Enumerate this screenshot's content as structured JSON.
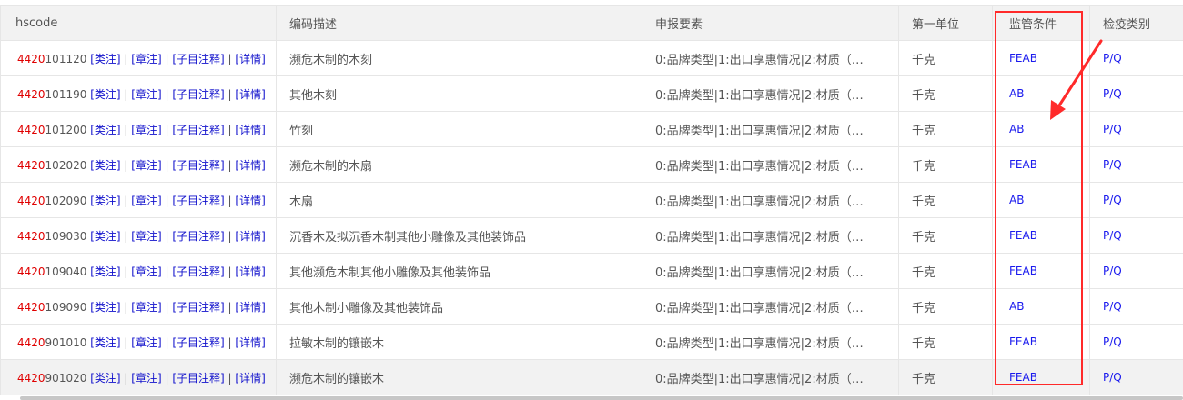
{
  "table": {
    "headers": [
      "hscode",
      "编码描述",
      "申报要素",
      "第一单位",
      "监管条件",
      "检疫类别"
    ],
    "link_labels": [
      "[类注]",
      "[章注]",
      "[子目注释]",
      "[详情]"
    ],
    "separator": "|",
    "rows": [
      {
        "prefix": "4420",
        "suffix": "101120",
        "desc": "濒危木制的木刻",
        "elements": "0:品牌类型|1:出口享惠情况|2:材质（…",
        "unit": "千克",
        "supervision": "FEAB",
        "quarantine": "P/Q"
      },
      {
        "prefix": "4420",
        "suffix": "101190",
        "desc": "其他木刻",
        "elements": "0:品牌类型|1:出口享惠情况|2:材质（…",
        "unit": "千克",
        "supervision": "AB",
        "quarantine": "P/Q"
      },
      {
        "prefix": "4420",
        "suffix": "101200",
        "desc": "竹刻",
        "elements": "0:品牌类型|1:出口享惠情况|2:材质（…",
        "unit": "千克",
        "supervision": "AB",
        "quarantine": "P/Q"
      },
      {
        "prefix": "4420",
        "suffix": "102020",
        "desc": "濒危木制的木扇",
        "elements": "0:品牌类型|1:出口享惠情况|2:材质（…",
        "unit": "千克",
        "supervision": "FEAB",
        "quarantine": "P/Q"
      },
      {
        "prefix": "4420",
        "suffix": "102090",
        "desc": "木扇",
        "elements": "0:品牌类型|1:出口享惠情况|2:材质（…",
        "unit": "千克",
        "supervision": "AB",
        "quarantine": "P/Q"
      },
      {
        "prefix": "4420",
        "suffix": "109030",
        "desc": "沉香木及拟沉香木制其他小雕像及其他装饰品",
        "elements": "0:品牌类型|1:出口享惠情况|2:材质（…",
        "unit": "千克",
        "supervision": "FEAB",
        "quarantine": "P/Q"
      },
      {
        "prefix": "4420",
        "suffix": "109040",
        "desc": "其他濒危木制其他小雕像及其他装饰品",
        "elements": "0:品牌类型|1:出口享惠情况|2:材质（…",
        "unit": "千克",
        "supervision": "FEAB",
        "quarantine": "P/Q"
      },
      {
        "prefix": "4420",
        "suffix": "109090",
        "desc": "其他木制小雕像及其他装饰品",
        "elements": "0:品牌类型|1:出口享惠情况|2:材质（…",
        "unit": "千克",
        "supervision": "AB",
        "quarantine": "P/Q"
      },
      {
        "prefix": "4420",
        "suffix": "901010",
        "desc": "拉敏木制的镶嵌木",
        "elements": "0:品牌类型|1:出口享惠情况|2:材质（…",
        "unit": "千克",
        "supervision": "FEAB",
        "quarantine": "P/Q"
      },
      {
        "prefix": "4420",
        "suffix": "901020",
        "desc": "濒危木制的镶嵌木",
        "elements": "0:品牌类型|1:出口享惠情况|2:材质（…",
        "unit": "千克",
        "supervision": "FEAB",
        "quarantine": "P/Q"
      }
    ]
  },
  "colors": {
    "hs_prefix": "#e00000",
    "link": "#1111cc",
    "highlight_box": "#ff2a2a",
    "header_bg": "#f2f2f2"
  }
}
